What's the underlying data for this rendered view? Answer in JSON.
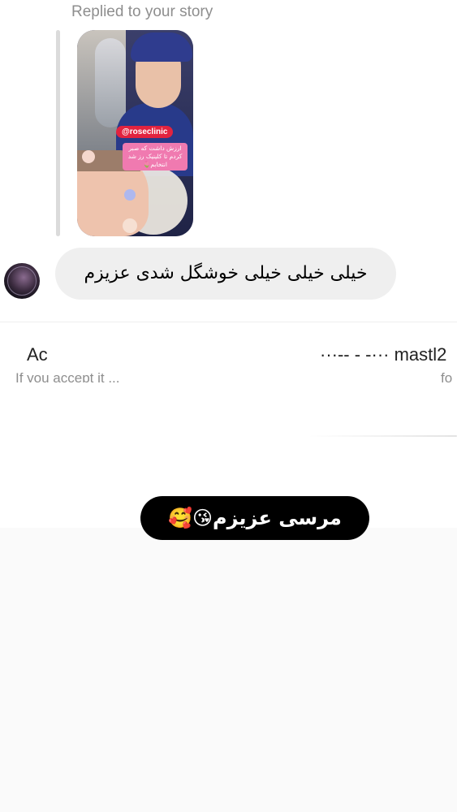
{
  "thread": {
    "replied_label": "Replied to your story",
    "story_sticker": "@roseclinic",
    "story_caption": "ارزش داشت که صبر کردم تا کلینیک رز شد انتخابم🌷",
    "received_message": "خیلی خیلی خیلی خوشگل شدی عزیزم",
    "notice": {
      "title_left": "Ac",
      "title_right": "···-- - -··· mastl2",
      "subtitle_left": "If you accept it ...",
      "subtitle_right": "fo"
    },
    "sent_message": "مرسی عزیزم😘🥰"
  },
  "colors": {
    "received_bubble": "#efefef",
    "sent_bubble": "#000000",
    "muted_text": "#8e8e8e",
    "sticker_red": "#e2233f"
  }
}
